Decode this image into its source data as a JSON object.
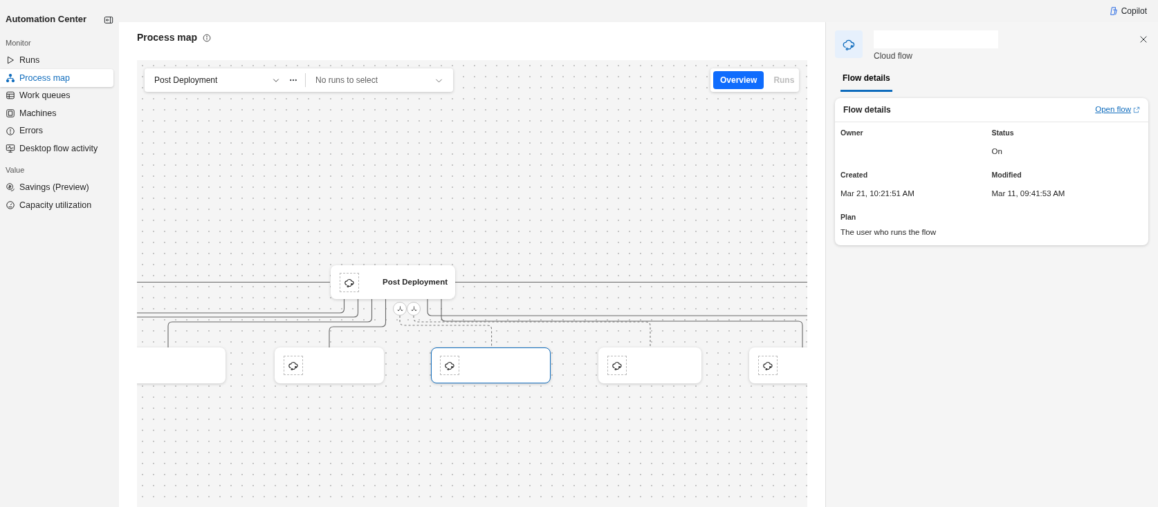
{
  "sidebar": {
    "title": "Automation Center",
    "sections": [
      {
        "heading": "Monitor",
        "items": [
          {
            "label": "Runs",
            "selected": false
          },
          {
            "label": "Process map",
            "selected": true
          },
          {
            "label": "Work queues",
            "selected": false
          },
          {
            "label": "Machines",
            "selected": false
          },
          {
            "label": "Errors",
            "selected": false
          },
          {
            "label": "Desktop flow activity",
            "selected": false
          }
        ]
      },
      {
        "heading": "Value",
        "items": [
          {
            "label": "Savings (Preview)",
            "selected": false
          },
          {
            "label": "Capacity utilization",
            "selected": false
          }
        ]
      }
    ]
  },
  "top_bar": {
    "copilot": "Copilot"
  },
  "main": {
    "title": "Process map",
    "toolbar": {
      "flow_select": "Post Deployment",
      "runs_select": {
        "placeholder": "No runs to select"
      }
    },
    "view_toggle": [
      {
        "label": "Overview",
        "selected": true,
        "disabled": false
      },
      {
        "label": "Runs",
        "selected": false,
        "disabled": true
      }
    ],
    "diagram": {
      "nodes": [
        {
          "label": "Post Deployment",
          "selected": false
        },
        {
          "selected": false
        },
        {
          "selected": false
        },
        {
          "selected": true
        },
        {
          "selected": false
        },
        {
          "selected": false
        }
      ]
    }
  },
  "details_panel": {
    "subtitle": "Cloud flow",
    "tabs": [
      {
        "label": "Flow details",
        "selected": true
      }
    ],
    "card": {
      "title": "Flow details",
      "link": "Open flow",
      "fields": [
        {
          "label": "Owner"
        },
        {
          "label": "Status",
          "value": "On"
        },
        {
          "label": "Created",
          "value": "Mar 21, 10:21:51 AM"
        },
        {
          "label": "Modified",
          "value": "Mar 11, 09:41:53 AM"
        },
        {
          "label": "Plan",
          "value": "The user who runs the flow"
        }
      ]
    }
  }
}
